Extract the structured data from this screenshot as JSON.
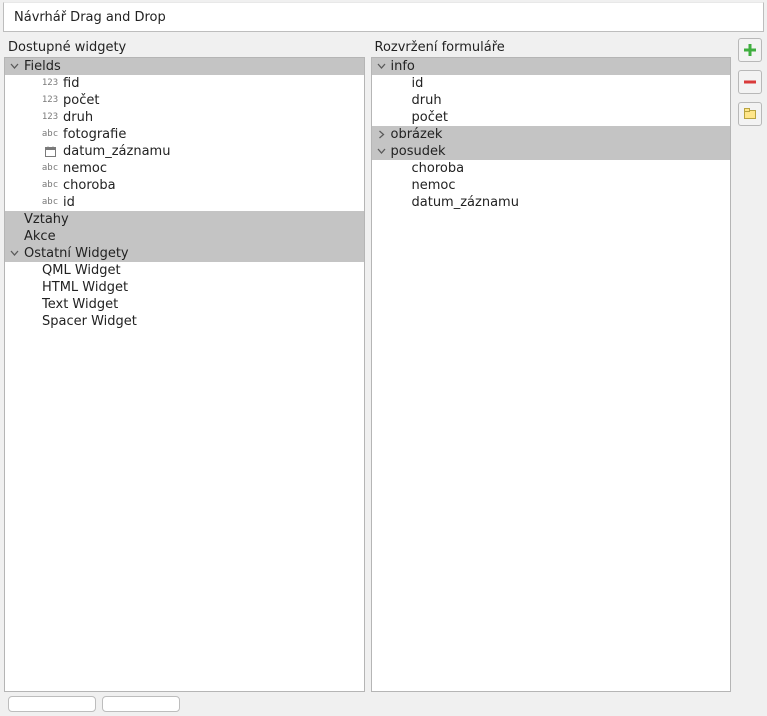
{
  "window": {
    "title": "Návrhář Drag and Drop"
  },
  "left": {
    "label": "Dostupné widgety",
    "fields_header": "Fields",
    "fields": [
      {
        "icon": "123",
        "label": "fid"
      },
      {
        "icon": "123",
        "label": "počet"
      },
      {
        "icon": "123",
        "label": "druh"
      },
      {
        "icon": "abc",
        "label": "fotografie"
      },
      {
        "icon": "cal",
        "label": "datum_záznamu"
      },
      {
        "icon": "abc",
        "label": "nemoc"
      },
      {
        "icon": "abc",
        "label": "choroba"
      },
      {
        "icon": "abc",
        "label": "id"
      }
    ],
    "vztahy": "Vztahy",
    "akce": "Akce",
    "ostatni_header": "Ostatní Widgety",
    "ostatni": [
      "QML Widget",
      "HTML Widget",
      "Text Widget",
      "Spacer Widget"
    ]
  },
  "right": {
    "label": "Rozvržení formuláře",
    "info_header": "info",
    "info_items": [
      "id",
      "druh",
      "počet"
    ],
    "obrazek": "obrázek",
    "posudek_header": "posudek",
    "posudek_items": [
      "choroba",
      "nemoc",
      "datum_záznamu"
    ]
  },
  "buttons": {
    "add": "add-tab",
    "remove": "remove-tab",
    "edit": "edit-tab"
  }
}
